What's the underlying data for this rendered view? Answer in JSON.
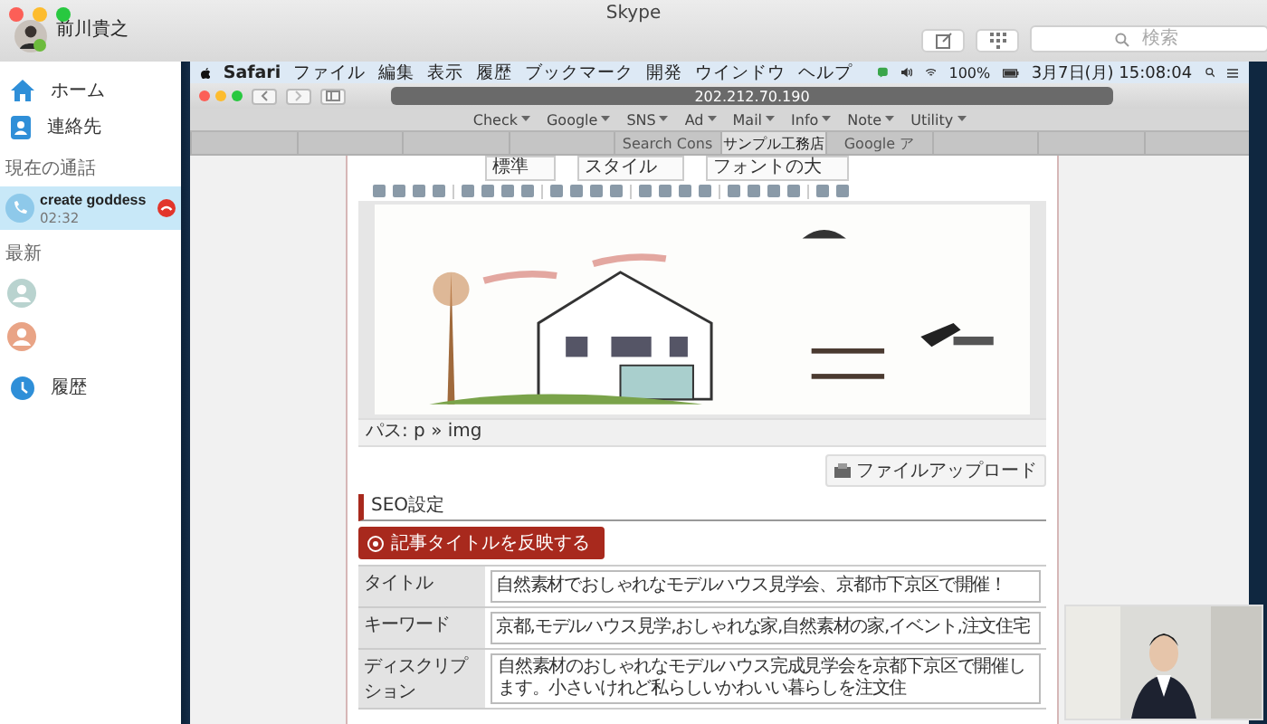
{
  "window": {
    "title": "Skype"
  },
  "user": {
    "name": "前川貴之"
  },
  "toolbar": {
    "search": {
      "placeholder": "検索"
    }
  },
  "sidebar": {
    "items": [
      {
        "label": "ホーム",
        "kind": "home"
      },
      {
        "label": "連絡先",
        "kind": "contacts"
      }
    ],
    "current_call": {
      "heading": "現在の通話",
      "name": "create goddess",
      "duration": "02:32",
      "selected": true
    },
    "recent": {
      "heading": "最新",
      "items": [
        {
          "color": "#b9d3cf"
        },
        {
          "color": "#e9a486"
        }
      ]
    },
    "history": {
      "label": "履歴"
    }
  },
  "shared_screen": {
    "menubar": {
      "app": "Safari",
      "menus": [
        "ファイル",
        "編集",
        "表示",
        "履歴",
        "ブックマーク",
        "開発",
        "ウインドウ",
        "ヘルプ"
      ],
      "battery": "100%",
      "clock": "3月7日(月) 15:08:04"
    },
    "browser": {
      "url": "202.212.70.190",
      "bookmarks": [
        "Check",
        "Google",
        "SNS",
        "Ad",
        "Mail",
        "Info",
        "Note",
        "Utility"
      ],
      "tabs": [
        {
          "label": "Search Cons",
          "selected": false
        },
        {
          "label": "サンプル工務店",
          "selected": true
        },
        {
          "label": "Google ア",
          "selected": false
        }
      ]
    },
    "editor": {
      "selects": [
        "標準",
        "スタイル",
        "フォントの大"
      ],
      "path": "パス: p » img"
    },
    "upload_button": "ファイルアップロード",
    "seo": {
      "heading": "SEO設定",
      "apply_button": "記事タイトルを反映する",
      "rows": [
        {
          "label": "タイトル",
          "value": "自然素材でおしゃれなモデルハウス見学会、京都市下京区で開催！"
        },
        {
          "label": "キーワード",
          "value": "京都,モデルハウス見学,おしゃれな家,自然素材の家,イベント,注文住宅"
        },
        {
          "label": "ディスクリプション",
          "value": "自然素材のおしゃれなモデルハウス完成見学会を京都下京区で開催します。小さいけれど私らしいかわいい暮らしを注文住"
        }
      ]
    }
  }
}
